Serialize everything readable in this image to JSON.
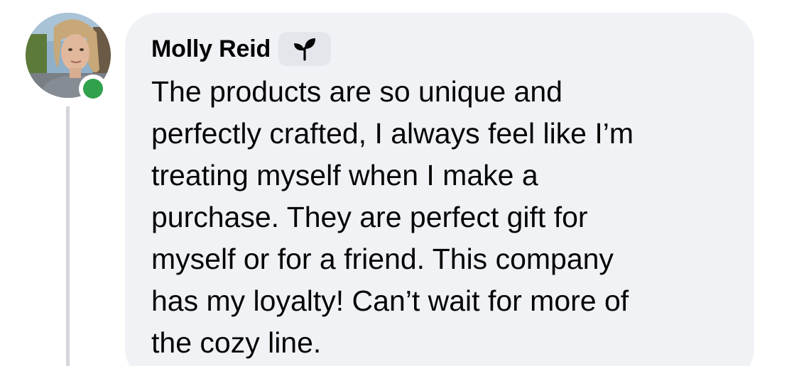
{
  "comment": {
    "author": "Molly Reid",
    "badge_icon": "sprout-icon",
    "presence": "online",
    "presence_color": "#31a24c",
    "bubble_color": "#f0f2f5",
    "text": "The products are so unique and\nperfectly crafted, I always feel like I’m\ntreating myself when I make a\npurchase. They are perfect gift for\nmyself or for a friend. This company\nhas my loyalty! Can’t wait for more of\nthe cozy line."
  }
}
